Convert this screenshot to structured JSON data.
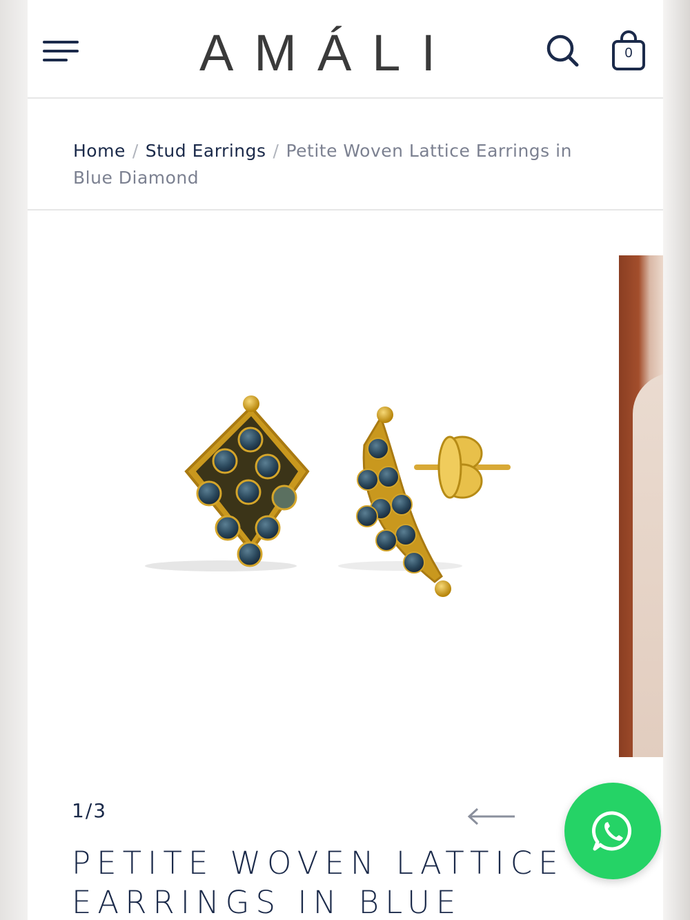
{
  "header": {
    "logo": "AMÁLI",
    "cart_count": "0"
  },
  "breadcrumb": {
    "items": [
      "Home",
      "Stud Earrings"
    ],
    "separator": "/",
    "current": "Petite Woven Lattice Earrings in Blue Diamond"
  },
  "gallery": {
    "counter": "1/3",
    "prev_arrow": "←"
  },
  "product": {
    "title": "PETITE WOVEN LATTICE EARRINGS IN BLUE DIAMOND"
  },
  "colors": {
    "navy": "#1b2a4a",
    "gold": "#c9981e",
    "stone_blue": "#2c4a5e",
    "whatsapp_green": "#25d366"
  },
  "icons": [
    "menu-icon",
    "search-icon",
    "shopping-bag-icon",
    "arrow-left-icon",
    "whatsapp-icon"
  ]
}
